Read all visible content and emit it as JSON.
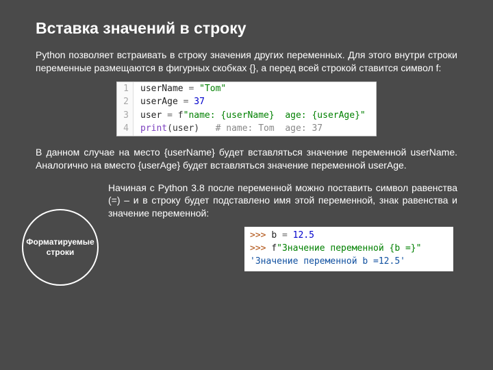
{
  "title": "Вставка значений в строку",
  "para1": "Python позволяет встраивать в строку значения других переменных. Для этого внутри строки переменные размещаются в фигурных скобках {}, а перед всей строкой ставится символ f:",
  "code1": {
    "lines": [
      {
        "n": "1",
        "a": "userName ",
        "op": "=",
        "b": " ",
        "str": "\"Tom\""
      },
      {
        "n": "2",
        "a": "userAge ",
        "op": "=",
        "b": " ",
        "num": "37"
      },
      {
        "n": "3",
        "a": "user ",
        "op": "=",
        "b": " f",
        "str": "\"name: {userName}  age: {userAge}\""
      },
      {
        "n": "4",
        "fn": "print",
        "paren": "(user)   ",
        "comment": "# name: Tom  age: 37"
      }
    ]
  },
  "para2": "В данном случае на место {userName} будет вставляться значение переменной userName. Аналогично на вместо {userAge} будет вставляться значение переменной userAge.",
  "circle": {
    "l1": "Форматируемые",
    "l2": "строки"
  },
  "para3": "Начиная с Python 3.8 после переменной можно поставить символ равенства (=) – и в  строку будет подставлено имя этой переменной, знак равенства и значение переменной:",
  "code2": {
    "p1": ">>> ",
    "l1a": "b ",
    "l1op": "= ",
    "l1num": "12.5",
    "p2": ">>> ",
    "l2f": "f",
    "l2str": "\"Значение переменной {b =}\"",
    "l3": "'Значение переменной b =12.5'"
  }
}
